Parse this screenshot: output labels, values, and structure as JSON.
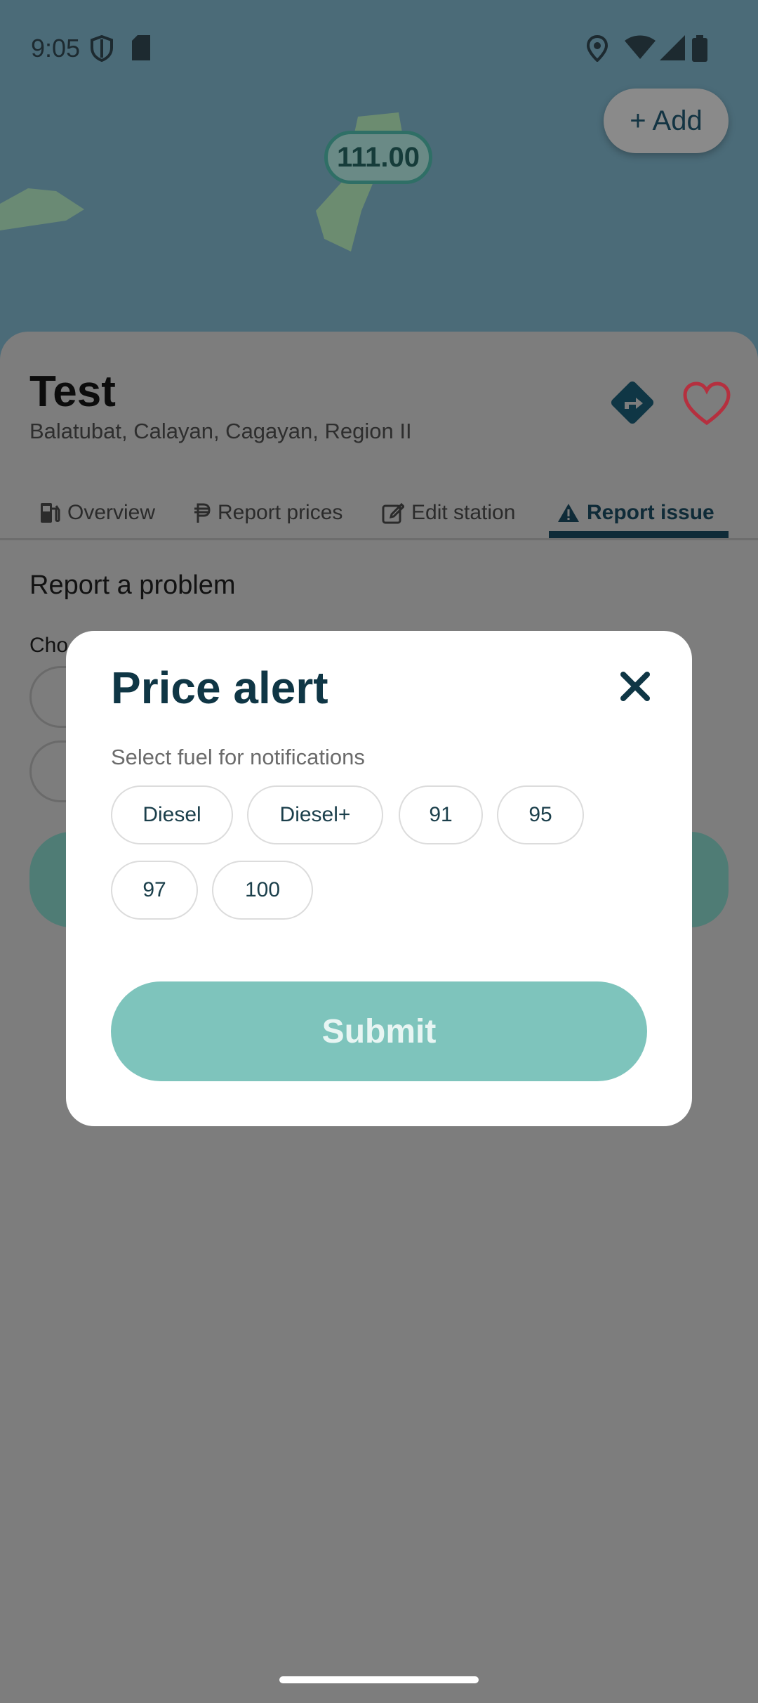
{
  "status_bar": {
    "time": "9:05"
  },
  "map": {
    "add_label": "+ Add",
    "price_marker": "111.00"
  },
  "station": {
    "name": "Test",
    "address": "Balatubat, Calayan, Cagayan, Region II",
    "tabs": [
      {
        "label": "Overview",
        "icon": "fuel-pump-icon"
      },
      {
        "label": "Report prices",
        "icon": "peso-icon"
      },
      {
        "label": "Edit station",
        "icon": "edit-icon"
      },
      {
        "label": "Report issue",
        "icon": "warning-icon",
        "active": true
      }
    ],
    "report_title": "Report a problem",
    "report_choose": "Cho"
  },
  "modal": {
    "title": "Price alert",
    "subtitle": "Select fuel for notifications",
    "fuels": [
      "Diesel",
      "Diesel+",
      "91",
      "95",
      "97",
      "100"
    ],
    "submit_label": "Submit"
  },
  "colors": {
    "primary": "#0f3645",
    "accent_disabled": "#7ec4bc",
    "favorite": "#d6394d"
  }
}
